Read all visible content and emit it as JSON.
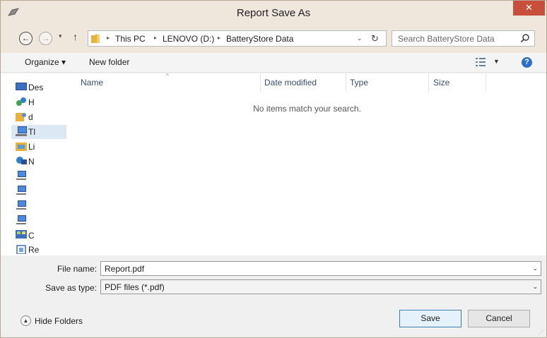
{
  "window": {
    "title": "Report Save As",
    "close_glyph": "✕"
  },
  "nav": {
    "back_glyph": "←",
    "forward_glyph": "→",
    "dropdown_glyph": "▾",
    "up_glyph": "↑",
    "breadcrumbs": [
      "This PC",
      "LENOVO (D:)",
      "BatteryStore Data"
    ],
    "separator_glyph": "▸",
    "address_drop_glyph": "⌄",
    "refresh_glyph": "↻",
    "search_placeholder": "Search BatteryStore Data"
  },
  "toolbar": {
    "organize_label": "Organize ▾",
    "new_folder_label": "New folder",
    "view_drop_glyph": "▼",
    "help_glyph": "?"
  },
  "nav_pane": {
    "items": [
      {
        "label": "Des",
        "icon": "desktop-icon"
      },
      {
        "label": "H",
        "icon": "homegroup-icon"
      },
      {
        "label": "d",
        "icon": "user-folder-icon"
      },
      {
        "label": "Tl",
        "icon": "this-pc-icon"
      },
      {
        "label": "Li",
        "icon": "libraries-icon"
      },
      {
        "label": "N",
        "icon": "network-icon"
      },
      {
        "label": "",
        "icon": "network-computer-icon"
      },
      {
        "label": "",
        "icon": "network-computer-icon"
      },
      {
        "label": "",
        "icon": "network-computer-icon"
      },
      {
        "label": "",
        "icon": "network-computer-icon"
      },
      {
        "label": "C",
        "icon": "control-panel-icon"
      },
      {
        "label": "Re",
        "icon": "recycle-bin-icon"
      }
    ],
    "selected_index": 3,
    "scroll_up_glyph": "^",
    "scroll_down_glyph": "v"
  },
  "file_list": {
    "columns": [
      "Name",
      "Date modified",
      "Type",
      "Size"
    ],
    "sort_glyph": "^",
    "empty_message": "No items match your search."
  },
  "form": {
    "file_name_label": "File name:",
    "file_name_value": "Report.pdf",
    "save_type_label": "Save as type:",
    "save_type_value": "PDF files (*.pdf)",
    "drop_glyph": "⌄"
  },
  "footer": {
    "hide_folders_label": "Hide Folders",
    "hide_glyph": "▲",
    "save_label": "Save",
    "cancel_label": "Cancel",
    "grip_glyph": "⋰"
  },
  "colors": {
    "title_bar": "#efe6dc",
    "close_button": "#c7503c",
    "selection": "#dde8f5",
    "help_icon": "#2b6fc9",
    "folder": "#e8b23a"
  }
}
